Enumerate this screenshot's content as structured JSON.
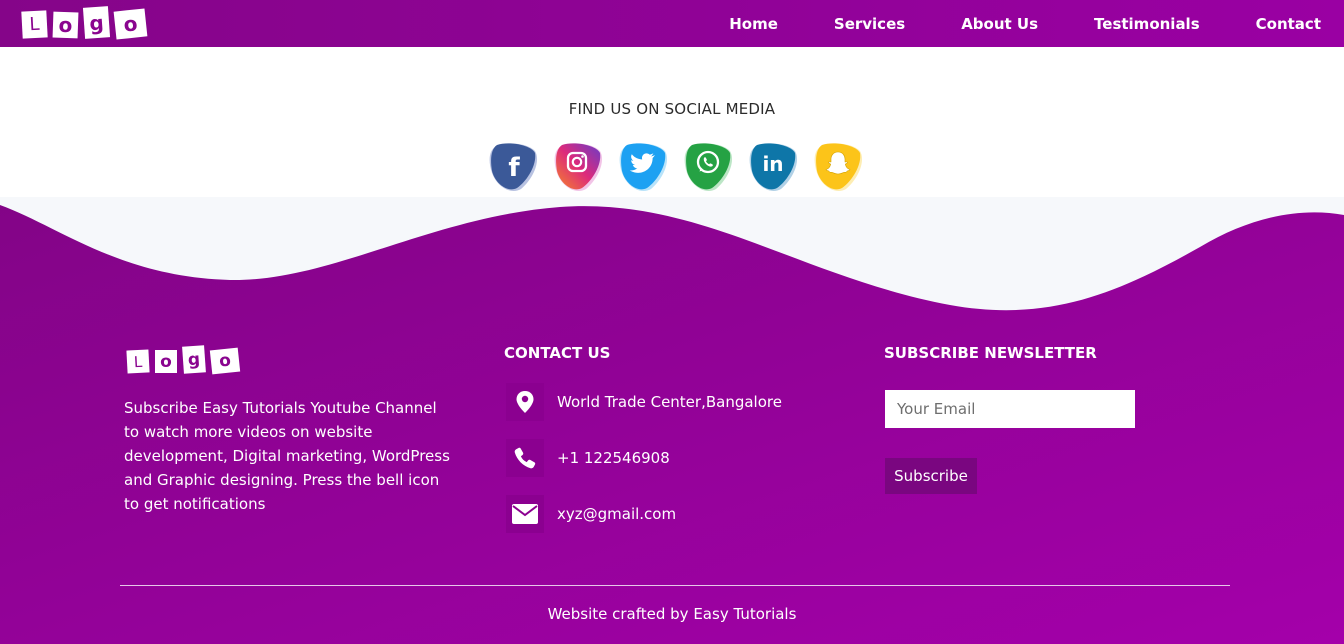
{
  "navbar": {
    "logo_letters": [
      "L",
      "o",
      "g",
      "o"
    ],
    "links": [
      "Home",
      "Services",
      "About Us",
      "Testimonials",
      "Contact"
    ]
  },
  "social": {
    "title": "FIND US ON SOCIAL MEDIA",
    "icons": [
      {
        "name": "facebook-icon",
        "color": "#3b5998"
      },
      {
        "name": "instagram-icon",
        "color": "#c13584"
      },
      {
        "name": "twitter-icon",
        "color": "#1da1f2"
      },
      {
        "name": "whatsapp-icon",
        "color": "#25a244"
      },
      {
        "name": "linkedin-icon",
        "color": "#0e76a8"
      },
      {
        "name": "snapchat-icon",
        "color": "#fcc419"
      }
    ]
  },
  "footer": {
    "logo_letters": [
      "L",
      "o",
      "g",
      "o"
    ],
    "about": "Subscribe Easy Tutorials Youtube Channel to watch more videos on website development, Digital marketing, WordPress and Graphic designing. Press the bell icon to get notifications",
    "contact": {
      "title": "CONTACT US",
      "address": "World Trade Center,Bangalore",
      "phone": "+1 122546908",
      "email": "xyz@gmail.com"
    },
    "newsletter": {
      "title": "SUBSCRIBE NEWSLETTER",
      "placeholder": "Your Email",
      "button": "Subscribe"
    },
    "copyright": "Website crafted by Easy Tutorials"
  },
  "colors": {
    "brand": "#8a058f",
    "brand_light": "#a100aa",
    "wave_band": "#f6f8fb"
  }
}
